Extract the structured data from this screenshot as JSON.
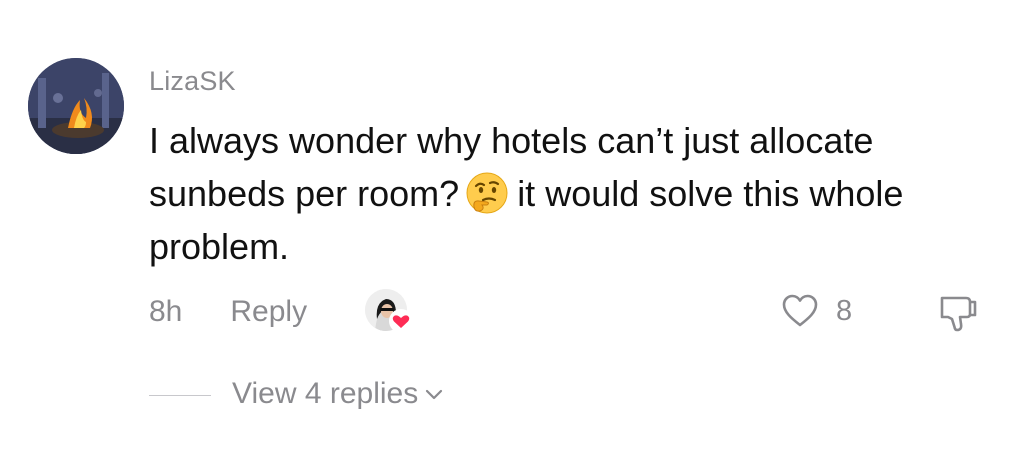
{
  "comment": {
    "username": "LizaSK",
    "text_part1": "I always wonder why hotels can’t just allocate sunbeds per room?",
    "emoji": "thinking-face",
    "text_part2": "it would solve this whole problem.",
    "timestamp": "8h",
    "reply_label": "Reply",
    "like_count": "8",
    "view_replies_label": "View 4 replies"
  },
  "icons": {
    "avatar": "user-avatar-fire-photo",
    "creator_like": "creator-liked-heart",
    "like": "heart-outline-icon",
    "dislike": "thumbs-down-icon",
    "expand": "chevron-down-icon"
  },
  "colors": {
    "text": "#111111",
    "muted": "#8a8a8e",
    "heart": "#fe2c55"
  }
}
